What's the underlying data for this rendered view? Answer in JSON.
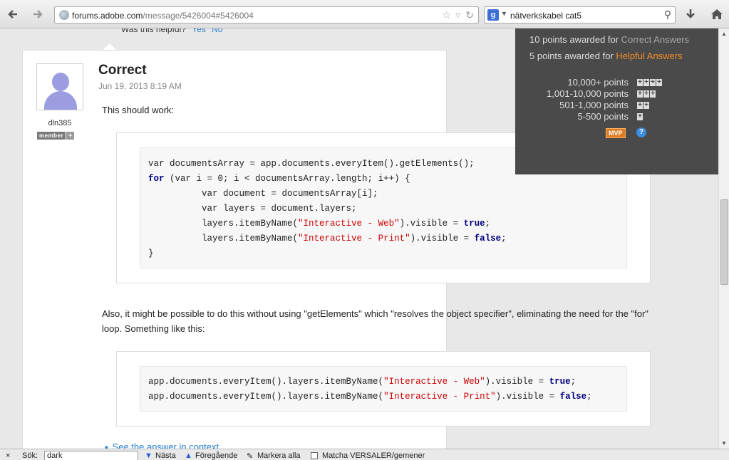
{
  "browser": {
    "url_domain": "forums.adobe.com",
    "url_path": "/message/5426004#5426004",
    "search_engine_label": "g",
    "search_query": "nätverkskabel cat5"
  },
  "post": {
    "helpful_label": "Was this helpful?",
    "yes_label": "Yes",
    "no_label": "No",
    "username": "dln385",
    "rank_badge": "member",
    "title": "Correct",
    "date": "Jun 19, 2013 8:19 AM",
    "intro": "This should work:",
    "middle_text": "Also, it might be possible to do this without using \"getElements\" which \"resolves the object specifier\", eliminating the need for the \"for\" loop. Something like this:",
    "answer_link": "See the answer in context"
  },
  "code1": [
    [
      {
        "t": "var documentsArray = app.documents.everyItem().getElements();"
      }
    ],
    [
      {
        "t": "for",
        "c": "kw"
      },
      {
        "t": " (var i = 0; i < documentsArray.length; i++) {"
      }
    ],
    [
      {
        "t": "          var document = documentsArray[i];"
      }
    ],
    [
      {
        "t": "          var layers = document.layers;"
      }
    ],
    [
      {
        "t": "          layers.itemByName("
      },
      {
        "t": "\"Interactive - Web\"",
        "c": "str"
      },
      {
        "t": ").visible = "
      },
      {
        "t": "true",
        "c": "kw"
      },
      {
        "t": ";"
      }
    ],
    [
      {
        "t": "          layers.itemByName("
      },
      {
        "t": "\"Interactive - Print\"",
        "c": "str"
      },
      {
        "t": ").visible = "
      },
      {
        "t": "false",
        "c": "kw"
      },
      {
        "t": ";"
      }
    ],
    [
      {
        "t": "}"
      }
    ]
  ],
  "code2": [
    [
      {
        "t": "app.documents.everyItem().layers.itemByName("
      },
      {
        "t": "\"Interactive - Web\"",
        "c": "str"
      },
      {
        "t": ").visible = "
      },
      {
        "t": "true",
        "c": "kw"
      },
      {
        "t": ";"
      }
    ],
    [
      {
        "t": "app.documents.everyItem().layers.itemByName("
      },
      {
        "t": "\"Interactive - Print\"",
        "c": "str"
      },
      {
        "t": ").visible = "
      },
      {
        "t": "false",
        "c": "kw"
      },
      {
        "t": ";"
      }
    ]
  ],
  "sidebar": {
    "correct_pts": "10 points awarded for ",
    "correct_link": "Correct Answers",
    "helpful_pts": "5 points awarded for ",
    "helpful_link": "Helpful Answers",
    "levels": [
      {
        "label": "10,000+ points",
        "badge": "++++"
      },
      {
        "label": "1,001-10,000 points",
        "badge": "+++"
      },
      {
        "label": "501-1,000 points",
        "badge": "++"
      },
      {
        "label": "5-500 points",
        "badge": "+"
      }
    ],
    "mvp_label": "MVP",
    "help_label": "?"
  },
  "findbar": {
    "close": "×",
    "label": "Sök:",
    "value": "dark",
    "next": "Nästa",
    "prev": "Föregående",
    "highlight": "Markera alla",
    "match_case": "Matcha VERSALER/gemener"
  },
  "colors": {
    "link": "#2a7fd4",
    "sidebar_bg": "#4a4a4a",
    "accent_orange": "#f28c28"
  }
}
